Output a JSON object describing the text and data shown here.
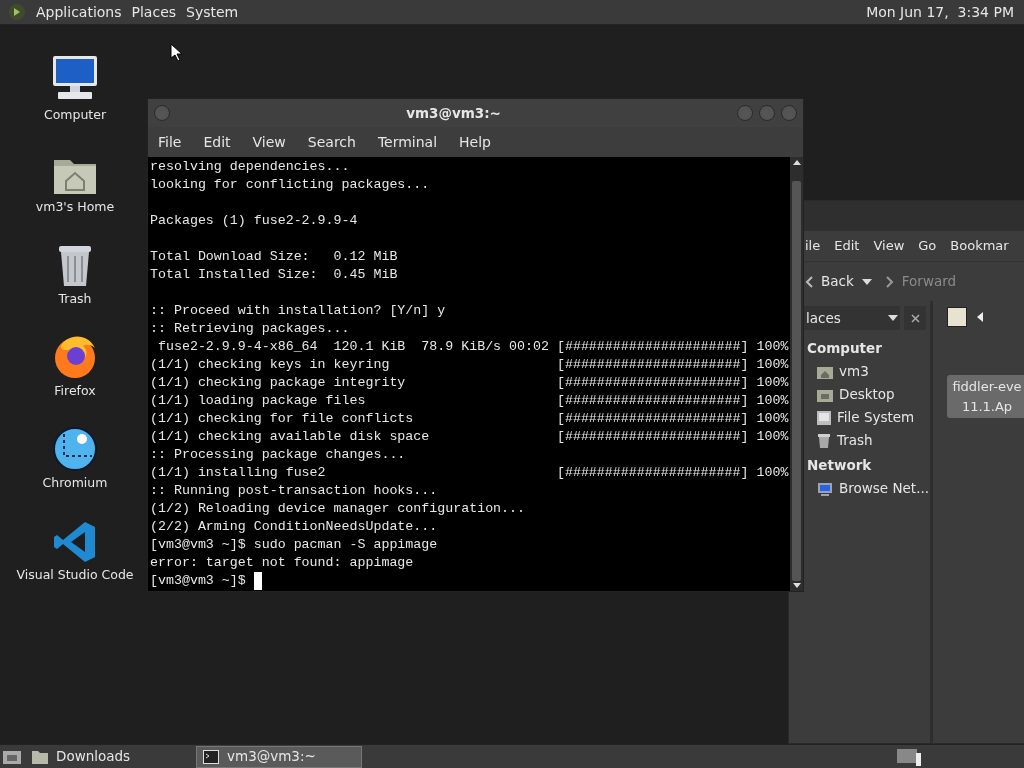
{
  "top_panel": {
    "menus": [
      "Applications",
      "Places",
      "System"
    ],
    "clock": "Mon Jun 17,  3:34 PM"
  },
  "desktop_icons": [
    {
      "kind": "computer",
      "label": "Computer"
    },
    {
      "kind": "home",
      "label": "vm3's Home"
    },
    {
      "kind": "trash",
      "label": "Trash"
    },
    {
      "kind": "firefox",
      "label": "Firefox"
    },
    {
      "kind": "chromium",
      "label": "Chromium"
    },
    {
      "kind": "vscode",
      "label": "Visual Studio Code"
    }
  ],
  "terminal": {
    "title": "vm3@vm3:~",
    "menu": [
      "File",
      "Edit",
      "View",
      "Search",
      "Terminal",
      "Help"
    ],
    "blocks": [
      [
        "resolving dependencies...",
        "looking for conflicting packages..."
      ],
      [
        "Packages (1) fuse2-2.9.9-4"
      ],
      [
        "Total Download Size:   0.12 MiB",
        "Total Installed Size:  0.45 MiB"
      ],
      [
        ":: Proceed with installation? [Y/n] y",
        ":: Retrieving packages...",
        " fuse2-2.9.9-4-x86_64  120.1 KiB  78.9 KiB/s 00:02 [######################] 100%",
        "(1/1) checking keys in keyring                     [######################] 100%",
        "(1/1) checking package integrity                   [######################] 100%",
        "(1/1) loading package files                        [######################] 100%",
        "(1/1) checking for file conflicts                  [######################] 100%",
        "(1/1) checking available disk space                [######################] 100%",
        ":: Processing package changes...",
        "(1/1) installing fuse2                             [######################] 100%",
        ":: Running post-transaction hooks...",
        "(1/2) Reloading device manager configuration...",
        "(2/2) Arming ConditionNeedsUpdate...",
        "[vm3@vm3 ~]$ sudo pacman -S appimage",
        "error: target not found: appimage",
        "[vm3@vm3 ~]$ "
      ]
    ],
    "cursor": true
  },
  "file_manager": {
    "menu": [
      "ile",
      "Edit",
      "View",
      "Go",
      "Bookmar"
    ],
    "back": "Back",
    "forward": "Forward",
    "side_pane": "laces",
    "sections": [
      {
        "title": "Computer",
        "items": [
          {
            "kind": "home",
            "label": "vm3"
          },
          {
            "kind": "desktop",
            "label": "Desktop"
          },
          {
            "kind": "drive",
            "label": "File System"
          },
          {
            "kind": "trash",
            "label": "Trash"
          }
        ]
      },
      {
        "title": "Network",
        "items": [
          {
            "kind": "network",
            "label": "Browse Net..."
          }
        ]
      }
    ],
    "file": {
      "lines": [
        "fiddler-eve",
        "11.1.Ap"
      ]
    }
  },
  "taskbar": [
    {
      "kind": "folder",
      "label": "Downloads",
      "selected": false
    },
    {
      "kind": "terminal",
      "label": "vm3@vm3:~",
      "selected": true
    }
  ]
}
